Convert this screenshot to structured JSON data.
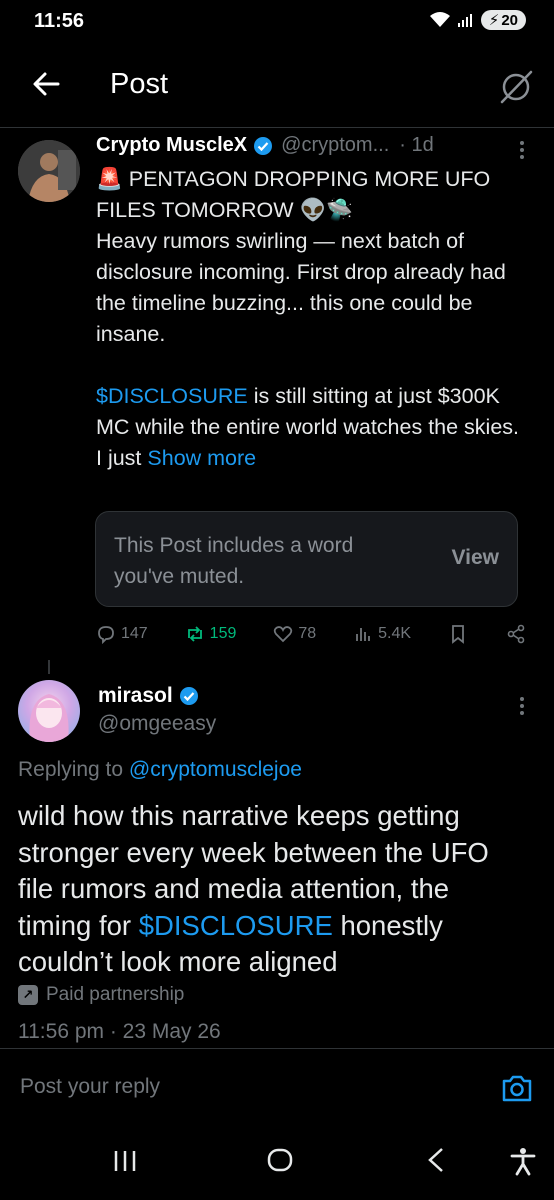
{
  "status_bar": {
    "time": "11:56",
    "battery": "20"
  },
  "header": {
    "title": "Post"
  },
  "parent_post": {
    "name": "Crypto MuscleX",
    "handle": "@cryptom...",
    "time": "· 1d",
    "lines": [
      "🚨 PENTAGON DROPPING MORE UFO FILES TOMORROW 👽🛸",
      "Heavy rumors swirling — next batch of disclosure incoming. First drop already had the timeline buzzing... this one could be insane."
    ],
    "ticker": "$DISCLOSURE",
    "ticker_rest": " is still sitting at just $300K MC while the entire world watches the skies.",
    "last_line_start": "I just ",
    "show_more": "Show more",
    "muted_notice": "This Post includes a word you've muted.",
    "view_label": "View",
    "replies": "147",
    "reposts": "159",
    "likes": "78",
    "views": "5.4K"
  },
  "reply_post": {
    "name": "mirasol",
    "handle": "@omgeeasy",
    "replying_prefix": "Replying to ",
    "replying_to": "@cryptomusclejoe",
    "body_before": "wild how this narrative keeps getting stronger every week between the UFO file rumors and media attention, the timing for ",
    "body_ticker": "$DISCLOSURE",
    "body_after": " honestly couldn’t look more aligned",
    "paid_label": "Paid partnership",
    "timestamp": "11:56 pm · 23 May 26"
  },
  "reply_bar": {
    "placeholder": "Post your reply"
  },
  "colors": {
    "link": "#1d9bf0",
    "repost_active": "#00ba7c",
    "muted_text": "#71767b"
  }
}
